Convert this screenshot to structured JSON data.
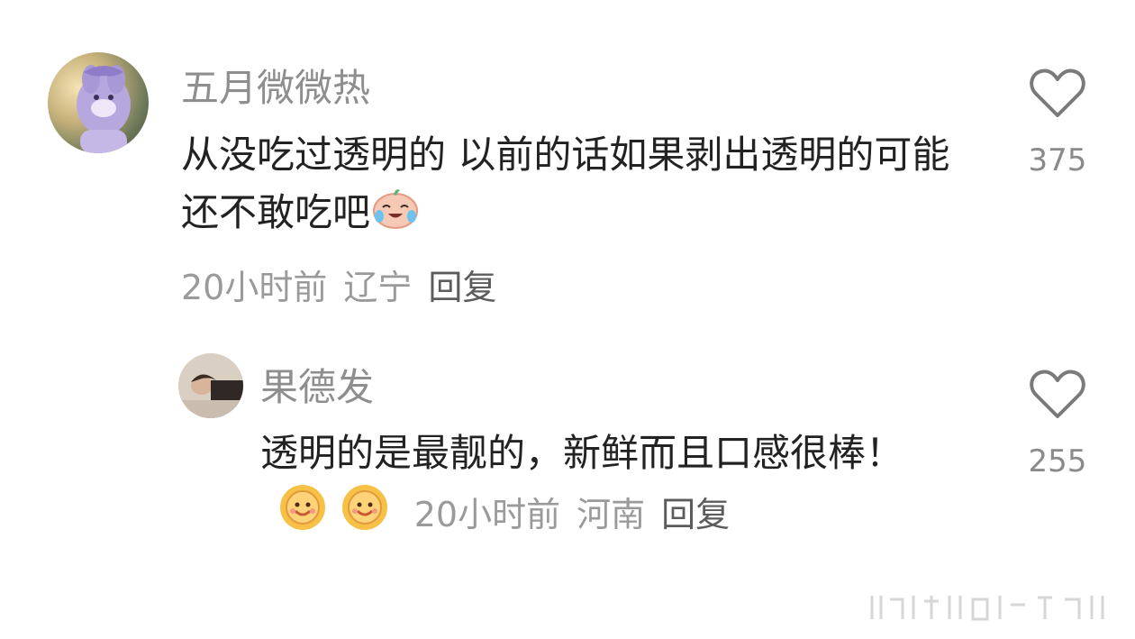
{
  "comments": [
    {
      "username": "五月微微热",
      "text": "从没吃过透明的 以前的话如果剥出透明的可能还不敢吃吧",
      "emoji": "laughing-crying-emoji",
      "time": "20小时前",
      "location": "辽宁",
      "reply_label": "回复",
      "likes": "375"
    },
    {
      "username": "果德发",
      "text": "透明的是最靓的，新鲜而且口感很棒！",
      "emoji": "smiling-sun-emoji",
      "time": "20小时前",
      "location": "河南",
      "reply_label": "回复",
      "likes": "255"
    }
  ],
  "colors": {
    "username": "#8e8e8e",
    "text": "#222222",
    "meta": "#9a9a9a",
    "heart_outline": "#7a7a7a"
  }
}
